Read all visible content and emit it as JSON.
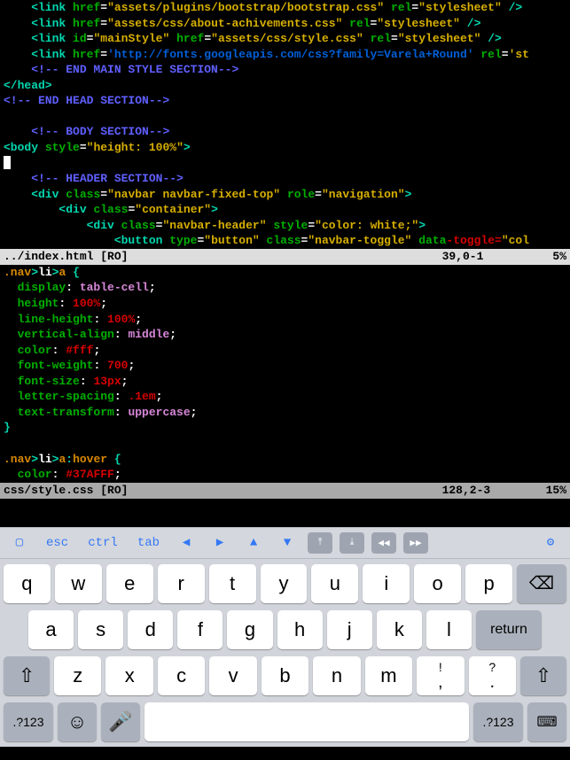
{
  "editor1": {
    "lines": [
      {
        "indent": "    ",
        "tokens": [
          {
            "c": "teal",
            "t": "<link"
          },
          {
            "c": "white",
            "t": " "
          },
          {
            "c": "green",
            "t": "href"
          },
          {
            "c": "white",
            "t": "="
          },
          {
            "c": "yellow",
            "t": "\"assets/plugins/bootstrap/bootstrap.css\""
          },
          {
            "c": "white",
            "t": " "
          },
          {
            "c": "green",
            "t": "rel"
          },
          {
            "c": "white",
            "t": "="
          },
          {
            "c": "yellow",
            "t": "\"stylesheet\""
          },
          {
            "c": "white",
            "t": " "
          },
          {
            "c": "teal",
            "t": "/>"
          }
        ]
      },
      {
        "indent": "    ",
        "tokens": [
          {
            "c": "teal",
            "t": "<link"
          },
          {
            "c": "white",
            "t": " "
          },
          {
            "c": "green",
            "t": "href"
          },
          {
            "c": "white",
            "t": "="
          },
          {
            "c": "yellow",
            "t": "\"assets/css/about-achivements.css\""
          },
          {
            "c": "white",
            "t": " "
          },
          {
            "c": "green",
            "t": "rel"
          },
          {
            "c": "white",
            "t": "="
          },
          {
            "c": "yellow",
            "t": "\"stylesheet\""
          },
          {
            "c": "white",
            "t": " "
          },
          {
            "c": "teal",
            "t": "/>"
          }
        ]
      },
      {
        "indent": "    ",
        "tokens": [
          {
            "c": "teal",
            "t": "<link"
          },
          {
            "c": "white",
            "t": " "
          },
          {
            "c": "green",
            "t": "id"
          },
          {
            "c": "white",
            "t": "="
          },
          {
            "c": "yellow",
            "t": "\"mainStyle\""
          },
          {
            "c": "white",
            "t": " "
          },
          {
            "c": "green",
            "t": "href"
          },
          {
            "c": "white",
            "t": "="
          },
          {
            "c": "yellow",
            "t": "\"assets/css/style.css\""
          },
          {
            "c": "white",
            "t": " "
          },
          {
            "c": "green",
            "t": "rel"
          },
          {
            "c": "white",
            "t": "="
          },
          {
            "c": "yellow",
            "t": "\"stylesheet\""
          },
          {
            "c": "white",
            "t": " "
          },
          {
            "c": "teal",
            "t": "/>"
          }
        ]
      },
      {
        "indent": "    ",
        "tokens": [
          {
            "c": "teal",
            "t": "<link"
          },
          {
            "c": "white",
            "t": " "
          },
          {
            "c": "green",
            "t": "href"
          },
          {
            "c": "white",
            "t": "="
          },
          {
            "c": "blue",
            "t": "'http://fonts.googleapis.com/css?family=Varela+Round'"
          },
          {
            "c": "white",
            "t": " "
          },
          {
            "c": "green",
            "t": "rel"
          },
          {
            "c": "white",
            "t": "="
          },
          {
            "c": "yellow",
            "t": "'st"
          }
        ]
      },
      {
        "indent": "    ",
        "tokens": [
          {
            "c": "comment",
            "t": "<!-- END MAIN STYLE SECTION-->"
          }
        ]
      },
      {
        "indent": "",
        "tokens": [
          {
            "c": "teal",
            "t": "</head>"
          }
        ]
      },
      {
        "indent": "",
        "tokens": [
          {
            "c": "comment",
            "t": "<!-- END HEAD SECTION-->"
          }
        ]
      },
      {
        "indent": "",
        "tokens": []
      },
      {
        "indent": "    ",
        "tokens": [
          {
            "c": "comment",
            "t": "<!-- BODY SECTION-->"
          }
        ]
      },
      {
        "indent": "",
        "tokens": [
          {
            "c": "teal",
            "t": "<body"
          },
          {
            "c": "white",
            "t": " "
          },
          {
            "c": "green",
            "t": "style"
          },
          {
            "c": "white",
            "t": "="
          },
          {
            "c": "yellow",
            "t": "\"height: 100%\""
          },
          {
            "c": "teal",
            "t": ">"
          }
        ]
      },
      {
        "indent": "",
        "tokens": [
          {
            "c": "cursor",
            "t": " "
          }
        ]
      },
      {
        "indent": "    ",
        "tokens": [
          {
            "c": "comment",
            "t": "<!-- HEADER SECTION-->"
          }
        ]
      },
      {
        "indent": "    ",
        "tokens": [
          {
            "c": "teal",
            "t": "<div"
          },
          {
            "c": "white",
            "t": " "
          },
          {
            "c": "green",
            "t": "class"
          },
          {
            "c": "white",
            "t": "="
          },
          {
            "c": "yellow",
            "t": "\"navbar navbar-fixed-top\""
          },
          {
            "c": "white",
            "t": " "
          },
          {
            "c": "green",
            "t": "role"
          },
          {
            "c": "white",
            "t": "="
          },
          {
            "c": "yellow",
            "t": "\"navigation\""
          },
          {
            "c": "teal",
            "t": ">"
          }
        ]
      },
      {
        "indent": "        ",
        "tokens": [
          {
            "c": "teal",
            "t": "<div"
          },
          {
            "c": "white",
            "t": " "
          },
          {
            "c": "green",
            "t": "class"
          },
          {
            "c": "white",
            "t": "="
          },
          {
            "c": "yellow",
            "t": "\"container\""
          },
          {
            "c": "teal",
            "t": ">"
          }
        ]
      },
      {
        "indent": "            ",
        "tokens": [
          {
            "c": "teal",
            "t": "<div"
          },
          {
            "c": "white",
            "t": " "
          },
          {
            "c": "green",
            "t": "class"
          },
          {
            "c": "white",
            "t": "="
          },
          {
            "c": "yellow",
            "t": "\"navbar-header\""
          },
          {
            "c": "white",
            "t": " "
          },
          {
            "c": "green",
            "t": "style"
          },
          {
            "c": "white",
            "t": "="
          },
          {
            "c": "yellow",
            "t": "\"color: white;\""
          },
          {
            "c": "teal",
            "t": ">"
          }
        ]
      },
      {
        "indent": "                ",
        "tokens": [
          {
            "c": "teal",
            "t": "<button"
          },
          {
            "c": "white",
            "t": " "
          },
          {
            "c": "green",
            "t": "type"
          },
          {
            "c": "white",
            "t": "="
          },
          {
            "c": "yellow",
            "t": "\"button\""
          },
          {
            "c": "white",
            "t": " "
          },
          {
            "c": "green",
            "t": "class"
          },
          {
            "c": "white",
            "t": "="
          },
          {
            "c": "yellow",
            "t": "\"navbar-toggle\""
          },
          {
            "c": "white",
            "t": " "
          },
          {
            "c": "green",
            "t": "data"
          },
          {
            "c": "red",
            "t": "-toggle="
          },
          {
            "c": "yellow",
            "t": "\"col"
          }
        ]
      }
    ]
  },
  "status1": {
    "left": "../index.html [RO]",
    "right_pos": "39,0-1",
    "right_pct": "5%"
  },
  "editor2": {
    "lines": [
      {
        "indent": "",
        "tokens": [
          {
            "c": "orange",
            "t": ".nav"
          },
          {
            "c": "teal",
            "t": ">"
          },
          {
            "c": "white",
            "t": "li"
          },
          {
            "c": "teal",
            "t": ">"
          },
          {
            "c": "orange",
            "t": "a"
          },
          {
            "c": "white",
            "t": " "
          },
          {
            "c": "teal",
            "t": "{"
          }
        ]
      },
      {
        "indent": "  ",
        "tokens": [
          {
            "c": "green",
            "t": "display"
          },
          {
            "c": "white",
            "t": ": "
          },
          {
            "c": "purple",
            "t": "table-cell"
          },
          {
            "c": "white",
            "t": ";"
          }
        ]
      },
      {
        "indent": "  ",
        "tokens": [
          {
            "c": "green",
            "t": "height"
          },
          {
            "c": "white",
            "t": ": "
          },
          {
            "c": "red",
            "t": "100%"
          },
          {
            "c": "white",
            "t": ";"
          }
        ]
      },
      {
        "indent": "  ",
        "tokens": [
          {
            "c": "green",
            "t": "line-height"
          },
          {
            "c": "white",
            "t": ": "
          },
          {
            "c": "red",
            "t": "100%"
          },
          {
            "c": "white",
            "t": ";"
          }
        ]
      },
      {
        "indent": "  ",
        "tokens": [
          {
            "c": "green",
            "t": "vertical-align"
          },
          {
            "c": "white",
            "t": ": "
          },
          {
            "c": "purple",
            "t": "middle"
          },
          {
            "c": "white",
            "t": ";"
          }
        ]
      },
      {
        "indent": "  ",
        "tokens": [
          {
            "c": "green",
            "t": "color"
          },
          {
            "c": "white",
            "t": ": "
          },
          {
            "c": "red",
            "t": "#fff"
          },
          {
            "c": "white",
            "t": ";"
          }
        ]
      },
      {
        "indent": "  ",
        "tokens": [
          {
            "c": "green",
            "t": "font-weight"
          },
          {
            "c": "white",
            "t": ": "
          },
          {
            "c": "red",
            "t": "700"
          },
          {
            "c": "white",
            "t": ";"
          }
        ]
      },
      {
        "indent": "  ",
        "tokens": [
          {
            "c": "green",
            "t": "font-size"
          },
          {
            "c": "white",
            "t": ": "
          },
          {
            "c": "red",
            "t": "13px"
          },
          {
            "c": "white",
            "t": ";"
          }
        ]
      },
      {
        "indent": "  ",
        "tokens": [
          {
            "c": "green",
            "t": "letter-spacing"
          },
          {
            "c": "white",
            "t": ": "
          },
          {
            "c": "red",
            "t": ".1em"
          },
          {
            "c": "white",
            "t": ";"
          }
        ]
      },
      {
        "indent": "  ",
        "tokens": [
          {
            "c": "green",
            "t": "text-transform"
          },
          {
            "c": "white",
            "t": ": "
          },
          {
            "c": "purple",
            "t": "uppercase"
          },
          {
            "c": "white",
            "t": ";"
          }
        ]
      },
      {
        "indent": "",
        "tokens": [
          {
            "c": "teal",
            "t": "}"
          }
        ]
      },
      {
        "indent": "",
        "tokens": []
      },
      {
        "indent": "",
        "tokens": [
          {
            "c": "orange",
            "t": ".nav"
          },
          {
            "c": "teal",
            "t": ">"
          },
          {
            "c": "white",
            "t": "li"
          },
          {
            "c": "teal",
            "t": ">"
          },
          {
            "c": "orange",
            "t": "a"
          },
          {
            "c": "teal",
            "t": ":"
          },
          {
            "c": "orange",
            "t": "hover"
          },
          {
            "c": "white",
            "t": " "
          },
          {
            "c": "teal",
            "t": "{"
          }
        ]
      },
      {
        "indent": "  ",
        "tokens": [
          {
            "c": "green",
            "t": "color"
          },
          {
            "c": "white",
            "t": ": "
          },
          {
            "c": "red",
            "t": "#37AFFF"
          },
          {
            "c": "white",
            "t": ";"
          }
        ]
      }
    ]
  },
  "status2": {
    "left": "css/style.css [RO]",
    "right_pos": "128,2-3",
    "right_pct": "15%"
  },
  "toolbar": {
    "esc": "esc",
    "ctrl": "ctrl",
    "tab": "tab"
  },
  "keyboard": {
    "row1": [
      "q",
      "w",
      "e",
      "r",
      "t",
      "y",
      "u",
      "i",
      "o",
      "p"
    ],
    "row2": [
      "a",
      "s",
      "d",
      "f",
      "g",
      "h",
      "j",
      "k",
      "l"
    ],
    "row3": [
      "z",
      "x",
      "c",
      "v",
      "b",
      "n",
      "m"
    ],
    "punc1": "!\n,",
    "punc2": "?\n.",
    "return": "return",
    "numkey": ".?123"
  }
}
